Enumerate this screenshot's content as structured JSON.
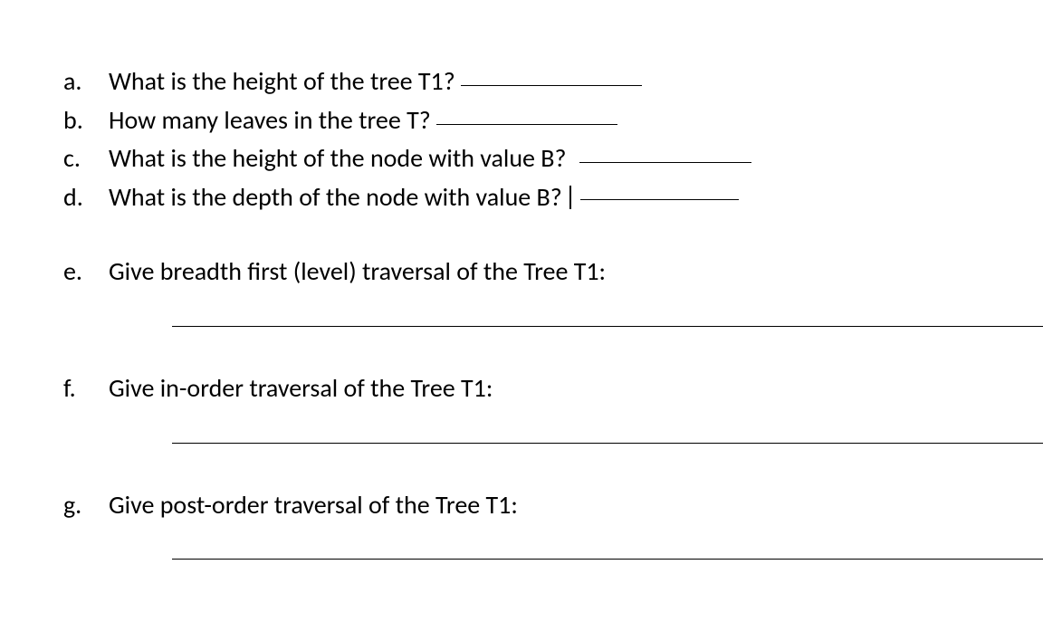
{
  "questions": {
    "a": {
      "label": "a.",
      "text": "What is the height of the tree T1?"
    },
    "b": {
      "label": "b.",
      "text": "How many leaves in the tree T?"
    },
    "c": {
      "label": "c.",
      "text": "What is the height of the node with value B?"
    },
    "d": {
      "label": "d.",
      "text": "What is the depth of the node with value B?"
    },
    "e": {
      "label": "e.",
      "text": "Give breadth first (level) traversal of the Tree T1:"
    },
    "f": {
      "label": "f.",
      "text": "Give in-order traversal of the Tree T1:"
    },
    "g": {
      "label": "g.",
      "text": "Give post-order traversal of the Tree T1:"
    }
  }
}
